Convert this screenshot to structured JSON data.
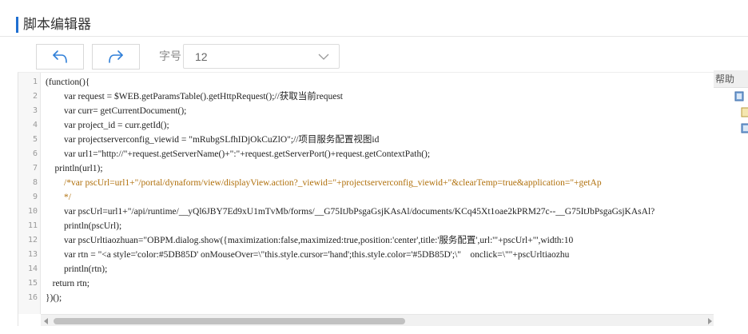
{
  "header": {
    "title": "脚本编辑器"
  },
  "toolbar": {
    "undo_icon": "undo-icon",
    "redo_icon": "redo-icon",
    "font_size_label": "字号",
    "font_size_value": "12"
  },
  "editor": {
    "line_numbers": [
      "1",
      "2",
      "3",
      "4",
      "5",
      "6",
      "7",
      "8",
      "9",
      "10",
      "11",
      "12",
      "13",
      "14",
      "15",
      "16"
    ],
    "lines": [
      "(function(){",
      "        var request = $WEB.getParamsTable().getHttpRequest();//获取当前request",
      "        var curr= getCurrentDocument();",
      "        var project_id = curr.getId();",
      "        var projectserverconfig_viewid = \"mRubgSLfhIDjOkCuZlO\";//项目服务配置视图id",
      "        var url1=\"http://\"+request.getServerName()+\":\"+request.getServerPort()+request.getContextPath();",
      "    println(url1);",
      "        /*var pscUrl=url1+\"/portal/dynaform/view/displayView.action?_viewid=\"+projectserverconfig_viewid+\"&clearTemp=true&application=\"+getAp",
      "        */",
      "        var pscUrl=url1+\"/api/runtime/__yQl6JBY7Ed9xU1mTvMb/forms/__G75ItJbPsgaGsjKAsAl/documents/KCq45Xt1oae2kPRM27c--__G75ItJbPsgaGsjKAsAl?",
      "        println(pscUrl);",
      "        var pscUrltiaozhuan=\"OBPM.dialog.show({maximization:false,maximized:true,position:'center',title:'服务配置',url:'\"+pscUrl+\"',width:10",
      "        var rtn = \"<a style='color:#5DB85D' onMouseOver=\\\"this.style.cursor='hand';this.style.color='#5DB85D';\\\"    onclick=\\\"\"+pscUrltiaozhu",
      "        println(rtn);",
      "   return rtn;",
      "})();"
    ]
  },
  "help": {
    "title": "帮助"
  }
}
